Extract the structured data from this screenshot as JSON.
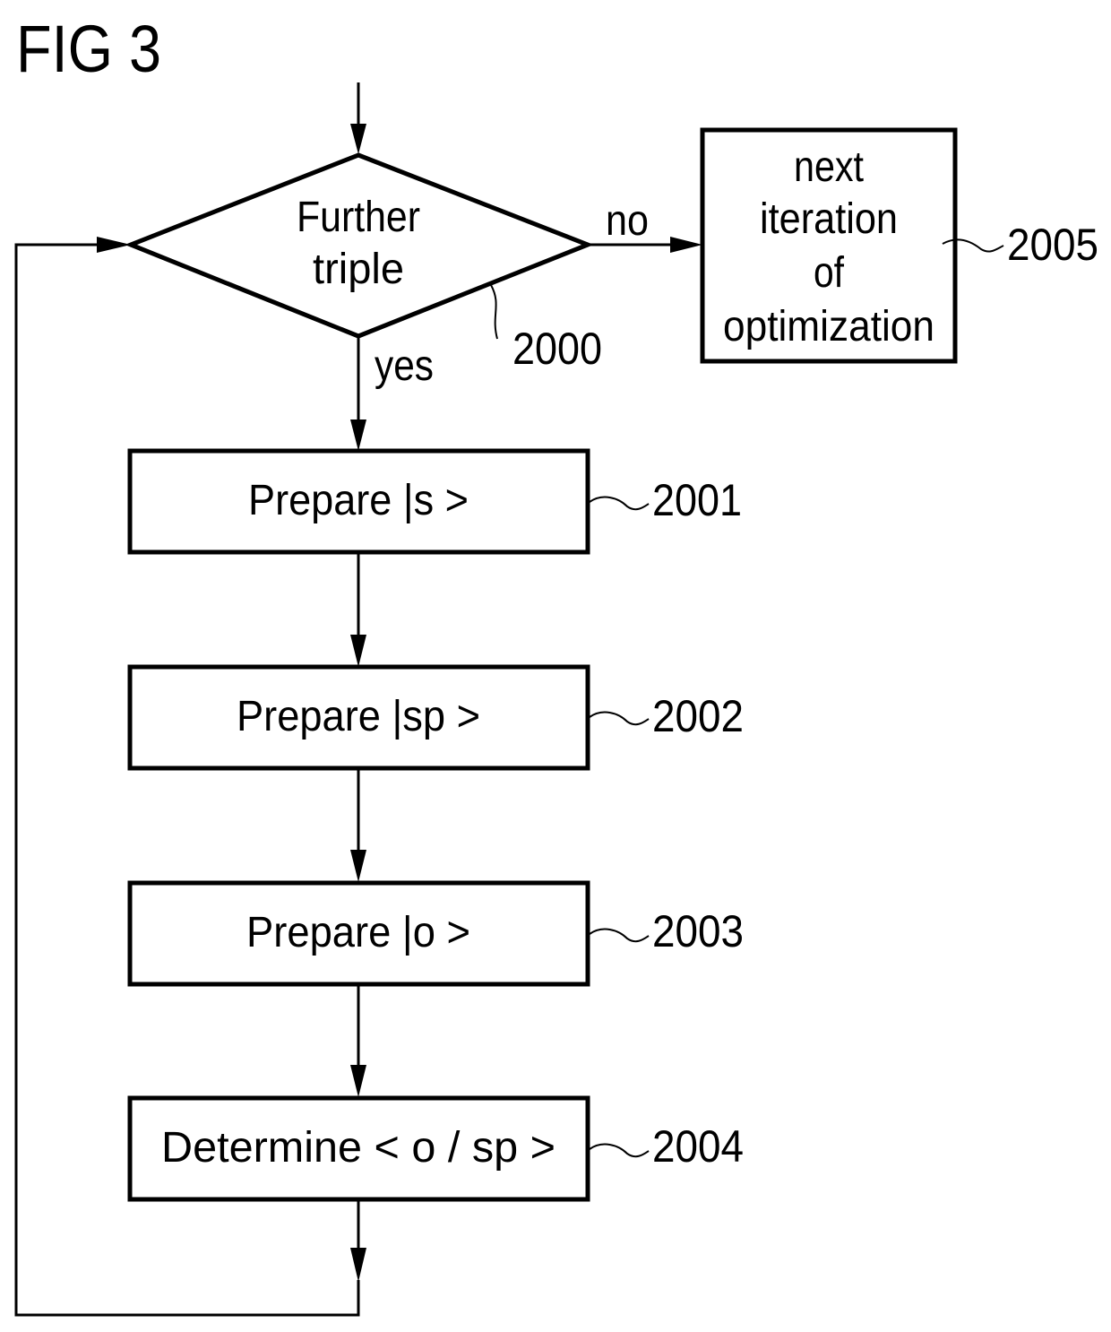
{
  "figure": {
    "title": "FIG 3"
  },
  "decision": {
    "id": "2000",
    "lines": [
      "Further",
      "triple"
    ],
    "yes_label": "yes",
    "no_label": "no"
  },
  "end_box": {
    "id": "2005",
    "lines": [
      "next",
      "iteration",
      "of",
      "optimization"
    ]
  },
  "steps": [
    {
      "id": "2001",
      "label": "Prepare |s >"
    },
    {
      "id": "2002",
      "label": "Prepare |sp >"
    },
    {
      "id": "2003",
      "label": "Prepare |o >"
    },
    {
      "id": "2004",
      "label": "Determine < o / sp >"
    }
  ],
  "colors": {
    "stroke": "#000000",
    "background": "#ffffff"
  }
}
